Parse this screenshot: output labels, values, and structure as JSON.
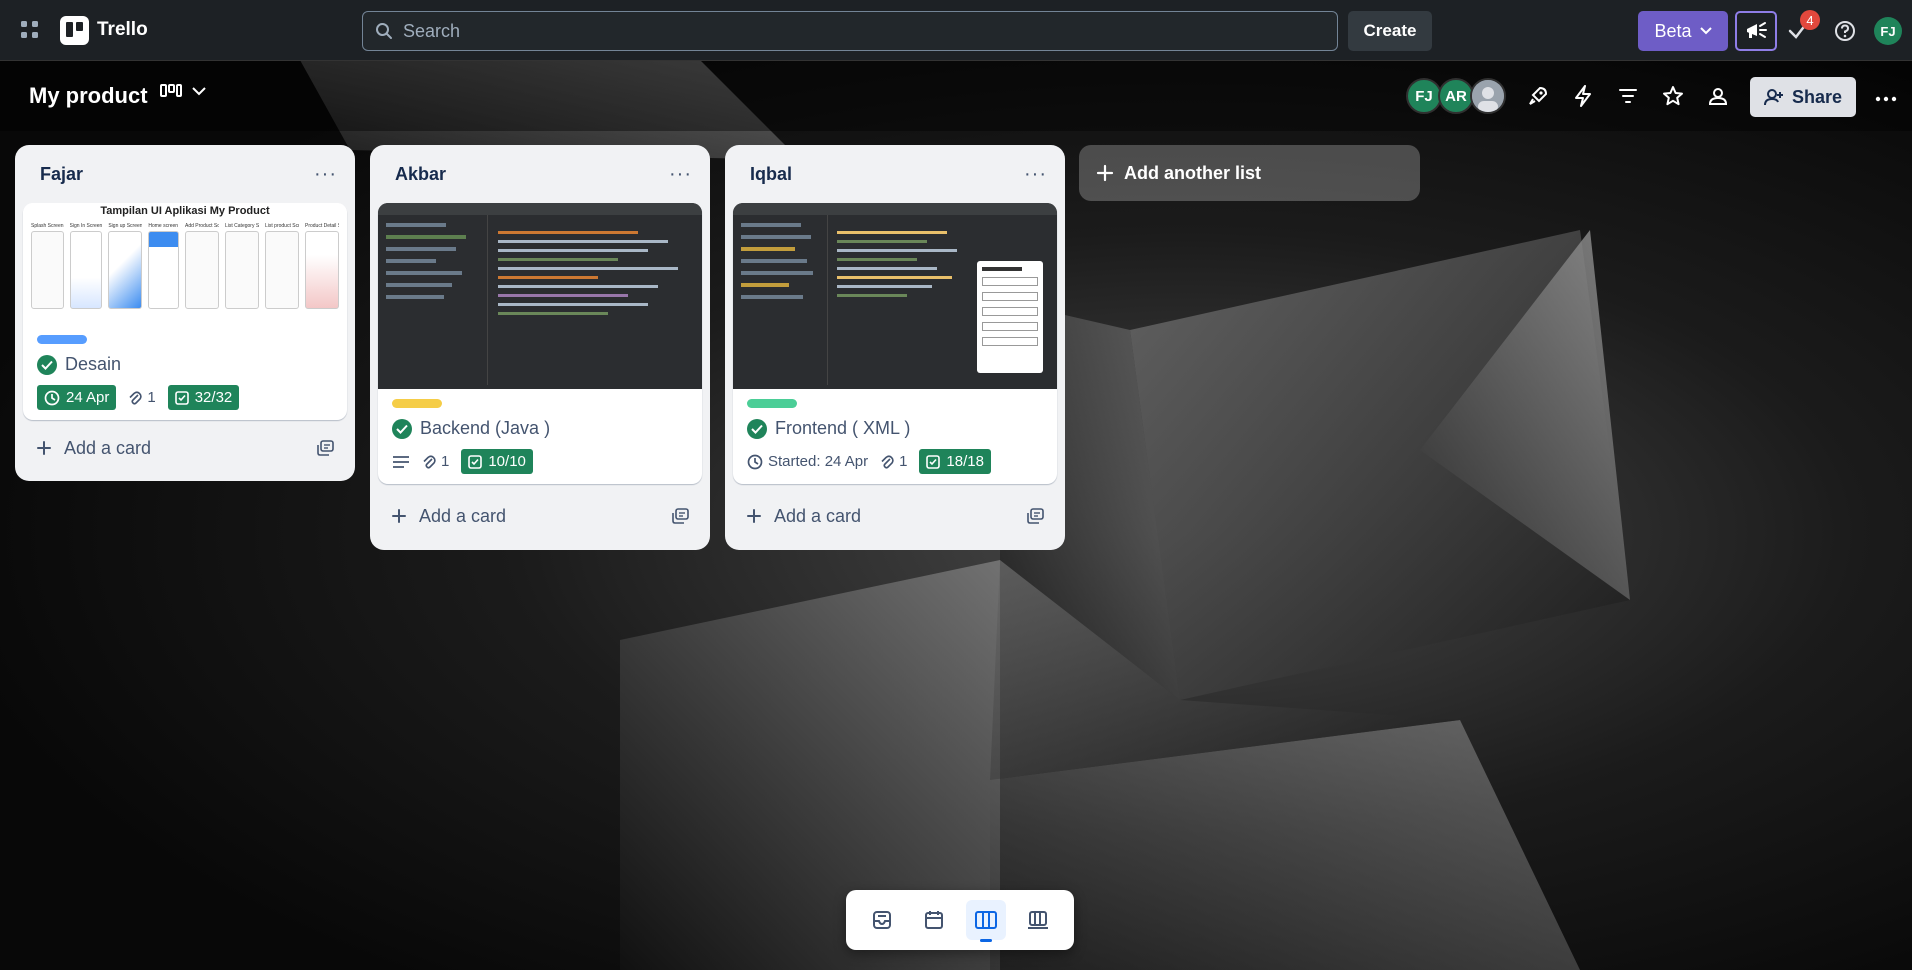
{
  "app": {
    "name": "Trello"
  },
  "search": {
    "placeholder": "Search"
  },
  "topbar": {
    "create_label": "Create",
    "beta_label": "Beta",
    "notification_count": "4",
    "user_initials": "FJ"
  },
  "board": {
    "title": "My product",
    "members": [
      {
        "initials": "FJ",
        "color": "#1f845a"
      },
      {
        "initials": "AR",
        "color": "#1f845a"
      },
      {
        "initials": "",
        "color": "#8590a2"
      }
    ],
    "share_label": "Share"
  },
  "lists": [
    {
      "title": "Fajar",
      "card": {
        "cover_title": "Tampilan UI Aplikasi My Product",
        "cover_caption_texts": [
          "Splash Screen",
          "Sign In Screen",
          "Sign up Screen",
          "Home screen",
          "Add Product Screen",
          "List Category Screen",
          "List product Screen",
          "Product Detail Screen"
        ],
        "label_color": "#579dff",
        "title": "Desain",
        "due": "24 Apr",
        "attachments": "1",
        "checklist": "32/32"
      },
      "add_card_label": "Add a card"
    },
    {
      "title": "Akbar",
      "card": {
        "label_color": "#f5cd47",
        "title": "Backend (Java )",
        "attachments": "1",
        "checklist": "10/10"
      },
      "add_card_label": "Add a card"
    },
    {
      "title": "Iqbal",
      "card": {
        "label_color": "#4bce97",
        "title": "Frontend ( XML )",
        "started": "Started: 24 Apr",
        "attachments": "1",
        "checklist": "18/18"
      },
      "add_card_label": "Add a card"
    }
  ],
  "add_list_label": "Add another list",
  "colors": {
    "accent": "#0c66e4",
    "complete_green": "#1f845a",
    "beta_purple": "#6e5dc6"
  }
}
